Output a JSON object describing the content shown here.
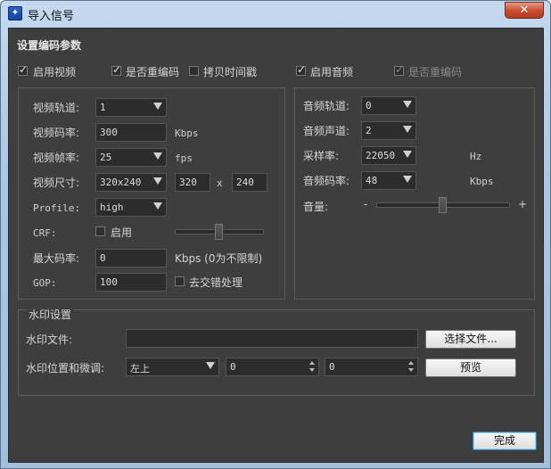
{
  "window": {
    "title": "导入信号",
    "app_icon": "app-icon",
    "close_icon": "close-icon"
  },
  "encode_section": {
    "title": "设置编码参数"
  },
  "video": {
    "enable_label": "启用视频",
    "enable_checked": true,
    "reencode_label": "是否重编码",
    "reencode_checked": true,
    "copy_ts_label": "拷贝时间戳",
    "copy_ts_checked": false,
    "track_label": "视频轨道:",
    "track_value": "1",
    "bitrate_label": "视频码率:",
    "bitrate_value": "300",
    "bitrate_unit": "Kbps",
    "fps_label": "视频帧率:",
    "fps_value": "25",
    "fps_unit": "fps",
    "size_label": "视频尺寸:",
    "size_value": "320x240",
    "width_value": "320",
    "size_x": "x",
    "height_value": "240",
    "profile_label": "Profile:",
    "profile_value": "high",
    "crf_label": "CRF:",
    "crf_enable_label": "启用",
    "crf_enable_checked": false,
    "crf_slider_fraction": 0.5,
    "max_bitrate_label": "最大码率:",
    "max_bitrate_value": "0",
    "max_bitrate_unit": "Kbps (0为不限制)",
    "gop_label": "GOP:",
    "gop_value": "100",
    "deinterlace_label": "去交错处理",
    "deinterlace_checked": false
  },
  "audio": {
    "enable_label": "启用音频",
    "enable_checked": true,
    "reencode_label": "是否重编码",
    "reencode_checked": true,
    "track_label": "音频轨道:",
    "track_value": "0",
    "channels_label": "音频声道:",
    "channels_value": "2",
    "sample_rate_label": "采样率:",
    "sample_rate_value": "22050",
    "sample_rate_unit": "Hz",
    "bitrate_label": "音频码率:",
    "bitrate_value": "48",
    "bitrate_unit": "Kbps",
    "volume_label": "音量:",
    "volume_minus": "-",
    "volume_plus": "+",
    "volume_fraction": 0.5
  },
  "watermark": {
    "title": "水印设置",
    "file_label": "水印文件:",
    "file_value": "",
    "choose_button": "选择文件...",
    "position_label": "水印位置和微调:",
    "position_value": "左上",
    "offset_x": "0",
    "offset_y": "0",
    "preview_button": "预览"
  },
  "footer": {
    "done_button": "完成"
  }
}
